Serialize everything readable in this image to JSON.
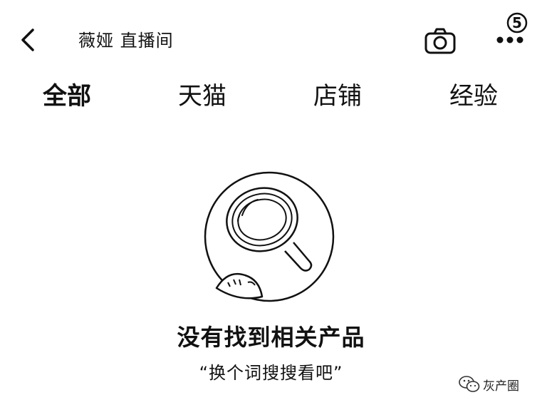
{
  "header": {
    "title": "薇娅 直播间",
    "badge": "5",
    "back_icon": "chevron-left-icon",
    "camera_icon": "camera-icon",
    "more_icon": "more-dots-icon"
  },
  "tabs": [
    {
      "label": "全部",
      "active": true
    },
    {
      "label": "天猫",
      "active": false
    },
    {
      "label": "店铺",
      "active": false
    },
    {
      "label": "经验",
      "active": false
    }
  ],
  "empty_state": {
    "icon": "magnifier-illustration-icon",
    "title": "没有找到相关产品",
    "hint": "“换个词搜搜看吧”"
  },
  "watermark": {
    "text": "灰产圈",
    "icon": "wechat-icon"
  }
}
